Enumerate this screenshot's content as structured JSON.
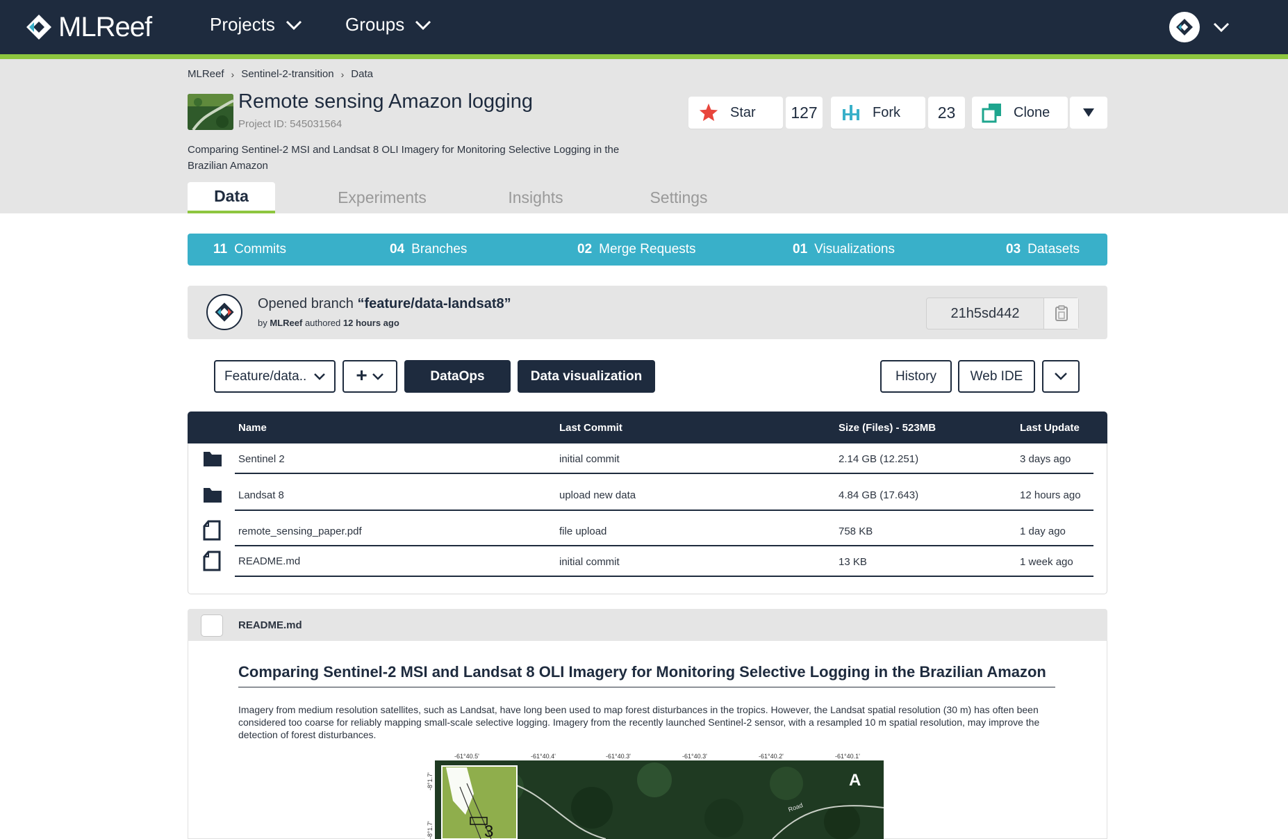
{
  "app": {
    "brand": "MLReef",
    "nav": [
      {
        "label": "Projects"
      },
      {
        "label": "Groups"
      }
    ]
  },
  "breadcrumb": [
    "MLReef",
    "Sentinel-2-transition",
    "Data"
  ],
  "project": {
    "title": "Remote sensing Amazon logging",
    "id_text": "Project ID: 545031564",
    "description": "Comparing Sentinel-2 MSI and Landsat 8 OLI Imagery for Monitoring Selective Logging in the Brazilian Amazon"
  },
  "actions": {
    "star_label": "Star",
    "star_count": "127",
    "fork_label": "Fork",
    "fork_count": "23",
    "clone_label": "Clone"
  },
  "tabs": [
    {
      "label": "Data",
      "active": true
    },
    {
      "label": "Experiments"
    },
    {
      "label": "Insights"
    },
    {
      "label": "Settings"
    }
  ],
  "stats": [
    {
      "num": "11",
      "label": "Commits"
    },
    {
      "num": "04",
      "label": "Branches"
    },
    {
      "num": "02",
      "label": "Merge Requests"
    },
    {
      "num": "01",
      "label": "Visualizations"
    },
    {
      "num": "03",
      "label": "Datasets"
    }
  ],
  "branch_info": {
    "prefix": "Opened branch",
    "branch": "“feature/data-landsat8”",
    "by": "by",
    "author": "MLReef",
    "authored": "authored",
    "time": "12 hours ago",
    "sha": "21h5sd442"
  },
  "toolbar": {
    "branch_select": "Feature/data..",
    "add_symbol": "+",
    "dataops": "DataOps",
    "data_viz": "Data visualization",
    "history": "History",
    "web_ide": "Web IDE"
  },
  "files": {
    "headers": [
      "Name",
      "Last Commit",
      "Size (Files) - 523MB",
      "Last Update"
    ],
    "rows": [
      {
        "type": "folder",
        "name": "Sentinel 2",
        "commit": "initial commit",
        "size": "2.14 GB (12.251)",
        "updated": "3 days ago"
      },
      {
        "type": "folder",
        "name": "Landsat 8",
        "commit": "upload new data",
        "size": "4.84 GB (17.643)",
        "updated": "12 hours ago"
      },
      {
        "type": "file",
        "name": "remote_sensing_paper.pdf",
        "commit": "file upload",
        "size": "758 KB",
        "updated": "1 day ago"
      },
      {
        "type": "file",
        "name": "README.md",
        "commit": "initial commit",
        "size": "13 KB",
        "updated": "1 week ago"
      }
    ]
  },
  "readme": {
    "filename": "README.md",
    "heading": "Comparing Sentinel-2 MSI and Landsat 8 OLI Imagery for Monitoring Selective Logging in the Brazilian Amazon",
    "paragraph": "Imagery from medium resolution satellites, such as Landsat, have long been used to map forest disturbances in the tropics. However, the Landsat spatial resolution (30 m) has often been considered too coarse for reliably mapping small-scale selective logging. Imagery from the recently launched Sentinel-2 sensor, with a resampled 10 m spatial resolution, may improve the detection of forest disturbances.",
    "figure": {
      "ticks": [
        "-61°40.5'",
        "-61°40.4'",
        "-61°40.3'",
        "-61°40.3'",
        "-61°40.2'",
        "-61°40.1'"
      ],
      "left_tick_a": "-8°1.7'",
      "left_tick_b": "-8°1.7'",
      "panel_letter": "A",
      "inset_number": "3",
      "road_label": "Road"
    }
  },
  "colors": {
    "navy": "#1e2b3e",
    "accent_green": "#8ec63f",
    "stats_teal": "#39b0c9",
    "star_red": "#e8453c",
    "fork_teal": "#39b0c9",
    "clone_teal": "#1ea58e"
  },
  "icons": [
    "mlreef-logo-icon",
    "chevron-down-icon",
    "star-icon",
    "fork-icon",
    "clone-icon",
    "caret-down-icon",
    "copy-icon",
    "folder-icon",
    "file-icon"
  ]
}
